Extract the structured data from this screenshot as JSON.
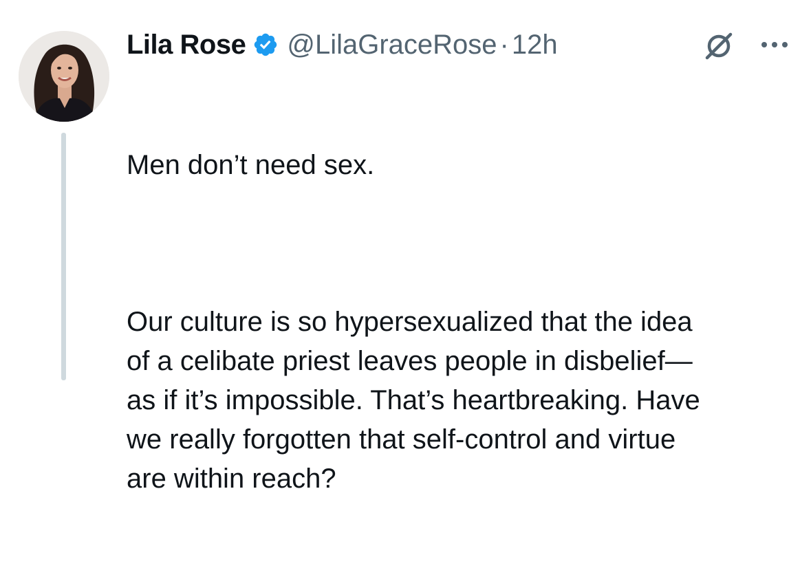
{
  "tweet": {
    "author_name": "Lila Rose",
    "handle": "@LilaGraceRose",
    "separator": "·",
    "time": "12h",
    "paragraphs": [
      "Men don’t need sex.",
      "Our culture is so hypersexualized that the idea\nof a celibate priest leaves people in disbelief—\nas if it’s impossible. That’s heartbreaking. Have\nwe really forgotten that self-control and virtue\nare within reach?"
    ]
  },
  "icons": {
    "verified": "verified-badge-icon",
    "grok": "grok-icon",
    "more": "more-options-icon"
  },
  "colors": {
    "verified_blue": "#1d9bf0",
    "secondary_text": "#536471",
    "primary_text": "#0f1419",
    "thread_line": "#cfd9de"
  }
}
